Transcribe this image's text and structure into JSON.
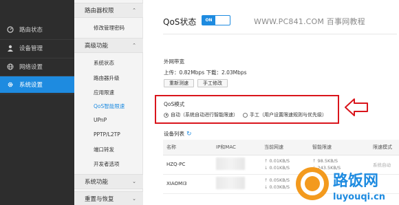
{
  "leftnav": {
    "items": [
      {
        "label": "路由状态",
        "icon": "gauge-icon"
      },
      {
        "label": "设备管理",
        "icon": "user-icon"
      },
      {
        "label": "网络设置",
        "icon": "globe-icon"
      },
      {
        "label": "系统设置",
        "icon": "gear-icon"
      }
    ],
    "active_index": 3
  },
  "subnav": {
    "sections": [
      {
        "label": "路由器权限",
        "chevron": "⌃",
        "items": [
          "修改管理密码"
        ]
      },
      {
        "label": "高级功能",
        "chevron": "⌃",
        "items": [
          "系统状态",
          "路由器升级",
          "应用限速",
          "QoS智能限速",
          "UPnP",
          "PPTP/L2TP",
          "端口转发",
          "开发者选项"
        ]
      },
      {
        "label": "系统功能",
        "chevron": "⌄",
        "items": []
      },
      {
        "label": "重置与恢复",
        "chevron": "⌄",
        "items": []
      }
    ],
    "active_item": "QoS智能限速"
  },
  "main": {
    "title": "QoS状态",
    "toggle_label": "ON",
    "watermark": "WWW.PC841.COM 百事网教程",
    "bandwidth_title": "外网带宽",
    "bandwidth_text": "上传：0.82Mbps 下载：2.03Mbps",
    "btn_retest": "重新测速",
    "btn_manual": "手工修改",
    "qos_mode_title": "QoS模式",
    "mode_auto": "自动（系统自动进行智能限速）",
    "mode_manual": "手工（用户设置限速规则与优先级）",
    "device_list_title": "设备列表",
    "table": {
      "headers": [
        "名称",
        "IP和MAC",
        "当前网速",
        "智能限速",
        "限速模式"
      ],
      "rows": [
        {
          "name": "HZQ-PC",
          "cur_up": "0.01KB/S",
          "cur_down": "0.01KB/S",
          "lim_up": "98.5KB/S",
          "lim_down": "243.5KB/S",
          "mode": "系统自动"
        },
        {
          "name": "XIAOMI3",
          "cur_up": "0.05KB/S",
          "cur_down": "0.03KB/S",
          "lim_up": "",
          "lim_down": "",
          "mode": ""
        }
      ]
    }
  },
  "logo": {
    "text": "路饭网",
    "sub": "luyouqi.cn"
  },
  "colors": {
    "accent": "#1e8be0",
    "nav_bg": "#2d2d2d",
    "annotation_red": "#d9141b"
  }
}
